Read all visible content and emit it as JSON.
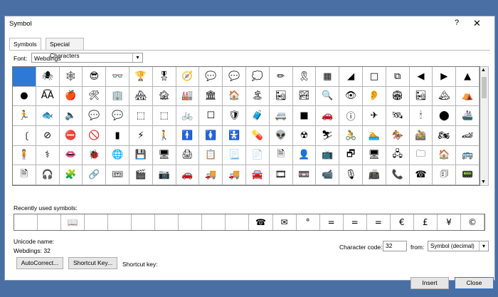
{
  "dialog": {
    "title": "Symbol",
    "help_label": "?",
    "close_glyph": "✕"
  },
  "tabs": [
    {
      "label": "Symbols",
      "active": true
    },
    {
      "label": "Special Characters",
      "active": false
    }
  ],
  "font": {
    "label": "Font:",
    "value": "Webdings"
  },
  "symbol_grid": {
    "selected_index": 0,
    "rows": [
      [
        " ",
        "🕷",
        "🕸",
        "😎",
        "👓",
        "🏆",
        "🎖",
        "🧭",
        "💬",
        "💬",
        "💭",
        "✏",
        "🎗",
        "▦",
        "◢",
        "□",
        "⧉",
        "◀",
        "▶",
        "▲"
      ],
      [
        "●",
        "A͡A",
        "🍎",
        "🛠",
        "🏢",
        "🏘",
        "🏚",
        "🏭",
        "🏛",
        "🏠",
        "🏝",
        "🏜",
        "🏞",
        "🔍",
        "👁",
        "👂",
        "🏟",
        "🏜",
        "🏔",
        "⛺"
      ],
      [
        "🏃",
        "🐟",
        "🔈",
        "💬",
        "💬",
        "⬚",
        "⬚",
        "🚲",
        "☐",
        "🛡",
        "🧳",
        "🚐",
        "■",
        "🚗",
        "ⓘ",
        "✈",
        "🛰",
        "🕯",
        "⬤",
        "🚢"
      ],
      [
        "〔",
        "⊘",
        "⛔",
        "🚫",
        "▮",
        "⚡",
        "🚶",
        "🚹",
        "🚺",
        "🚼",
        "💊",
        "👽",
        "☢",
        "⛷",
        "🚴",
        "🏊",
        "🏇",
        "🚵",
        "🏍",
        "🏎"
      ],
      [
        "🧍",
        "⚕",
        "👄",
        "🐞",
        "🌐",
        "💾",
        "🖥",
        "🖨",
        "📋",
        "📃",
        "📄",
        "🗎",
        "👤",
        "📺",
        "🗗",
        "🖥",
        "🖧",
        "🗀",
        "🏠",
        "🚌"
      ],
      [
        "🗎",
        "🎧",
        "🧩",
        "🔗",
        "🎟",
        "🎬",
        "📷",
        "🚗",
        "🚚",
        "🚚",
        "🚘",
        "🎞",
        "📼",
        "📹",
        "🎙",
        "📠",
        "📞",
        "☎",
        "🗊",
        "📟"
      ]
    ]
  },
  "recent": {
    "label": "Recently used symbols:",
    "symbols": [
      "",
      "",
      "📖",
      "",
      "",
      "",
      "",
      "",
      "",
      "",
      "☎",
      "✉",
      "°",
      "=",
      "=",
      "=",
      "€",
      "£",
      "¥",
      "©"
    ]
  },
  "info": {
    "unicode_name_label": "Unicode name:",
    "charset_info": "Webdings: 32"
  },
  "character_code": {
    "label": "Character code:",
    "value": "32"
  },
  "from": {
    "label": "from:",
    "value": "Symbol (decimal)"
  },
  "buttons": {
    "autocorrect": "AutoCorrect...",
    "shortcut": "Shortcut Key...",
    "shortcut_key_label": "Shortcut key:",
    "insert": "Insert",
    "close": "Close"
  },
  "colors": {
    "desktop": "#4a6fa5",
    "selection": "#2e78d6"
  }
}
